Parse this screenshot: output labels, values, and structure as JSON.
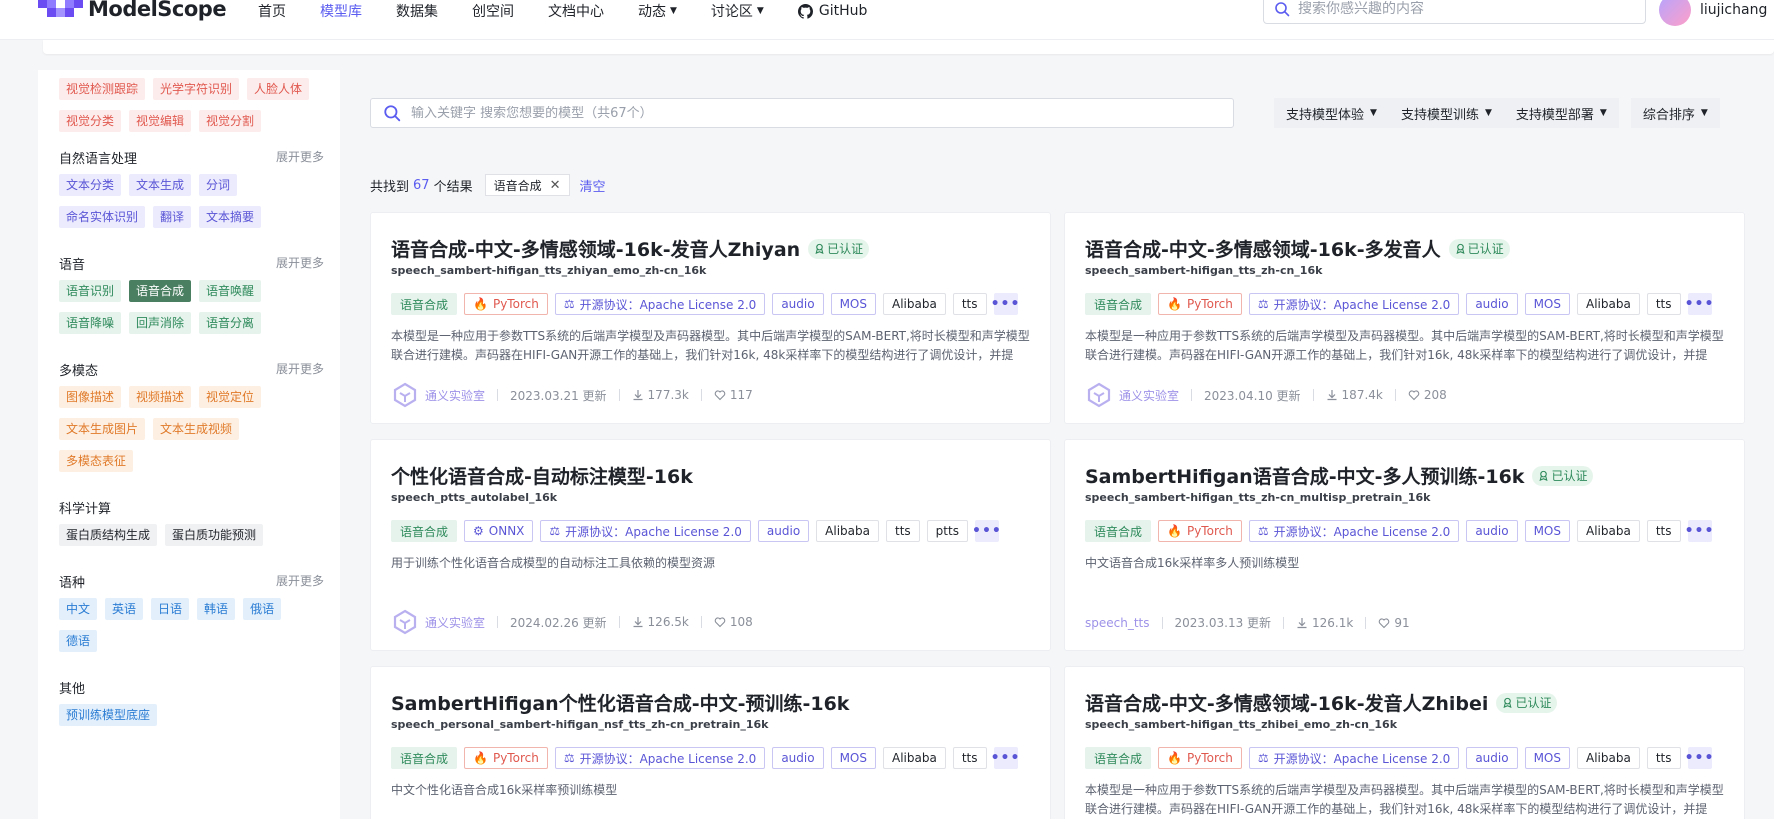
{
  "header": {
    "logo_text": "ModelScope",
    "nav": [
      {
        "label": "首页",
        "caret": false
      },
      {
        "label": "模型库",
        "caret": false
      },
      {
        "label": "数据集",
        "caret": false
      },
      {
        "label": "创空间",
        "caret": false
      },
      {
        "label": "文档中心",
        "caret": false
      },
      {
        "label": "动态",
        "caret": true
      },
      {
        "label": "讨论区",
        "caret": true
      }
    ],
    "github_label": "GitHub",
    "search_placeholder": "搜索你感兴趣的内容",
    "username": "liujichang",
    "accent": "#5b5cf0"
  },
  "sidebar": {
    "vision_tags": [
      "视觉检测跟踪",
      "光学字符识别",
      "人脸人体",
      "视觉分类",
      "视觉编辑",
      "视觉分割"
    ],
    "groups": [
      {
        "title": "自然语言处理",
        "more": "展开更多",
        "tags": [
          "文本分类",
          "文本生成",
          "分词",
          "命名实体识别",
          "翻译",
          "文本摘要"
        ]
      },
      {
        "title": "语音",
        "more": "展开更多",
        "tags": [
          "语音识别",
          "语音合成",
          "语音唤醒",
          "语音降噪",
          "回声消除",
          "语音分离"
        ],
        "active": "语音合成"
      },
      {
        "title": "多模态",
        "more": "展开更多",
        "tags": [
          "图像描述",
          "视频描述",
          "视觉定位",
          "文本生成图片",
          "文本生成视频",
          "多模态表征"
        ]
      },
      {
        "title": "科学计算",
        "tags": [
          "蛋白质结构生成",
          "蛋白质功能预测"
        ]
      },
      {
        "title": "语种",
        "more": "展开更多",
        "tags": [
          "中文",
          "英语",
          "日语",
          "韩语",
          "俄语",
          "德语"
        ]
      },
      {
        "title": "其他",
        "tags": [
          "预训练模型底座"
        ]
      }
    ]
  },
  "main": {
    "search_placeholder": "输入关键字 搜索您想要的模型（共67个）",
    "filters": [
      "支持模型体验",
      "支持模型训练",
      "支持模型部署"
    ],
    "sort_label": "综合排序",
    "result_prefix": "共找到",
    "result_count": "67",
    "result_suffix": "个结果",
    "active_filter": "语音合成",
    "clear_label": "清空",
    "cards": [
      {
        "title": "语音合成-中文-多情感领域-16k-发音人Zhiyan",
        "certified": "已认证",
        "sub": "speech_sambert-hifigan_tts_zhiyan_emo_zh-cn_16k",
        "tags": [
          "语音合成",
          "PyTorch",
          "开源协议：Apache License 2.0",
          "audio",
          "MOS",
          "Alibaba",
          "tts"
        ],
        "desc": "本模型是一种应用于参数TTS系统的后端声学模型及声码器模型。其中后端声学模型的SAM-BERT,将时长模型和声学模型联合进行建模。声码器在HIFI-GAN开源工作的基础上，我们针对16k, 48k采样率下的模型结构进行了调优设计，并提供…",
        "org": "通义实验室",
        "updated": "2023.03.21 更新",
        "downloads": "177.3k",
        "likes": "117"
      },
      {
        "title": "语音合成-中文-多情感领域-16k-多发音人",
        "certified": "已认证",
        "sub": "speech_sambert-hifigan_tts_zh-cn_16k",
        "tags": [
          "语音合成",
          "PyTorch",
          "开源协议：Apache License 2.0",
          "audio",
          "MOS",
          "Alibaba",
          "tts"
        ],
        "desc": "本模型是一种应用于参数TTS系统的后端声学模型及声码器模型。其中后端声学模型的SAM-BERT,将时长模型和声学模型联合进行建模。声码器在HIFI-GAN开源工作的基础上，我们针对16k, 48k采样率下的模型结构进行了调优设计，并提供…",
        "org": "通义实验室",
        "updated": "2023.04.10 更新",
        "downloads": "187.4k",
        "likes": "208"
      },
      {
        "title": "个性化语音合成-自动标注模型-16k",
        "certified": "",
        "sub": "speech_ptts_autolabel_16k",
        "tags": [
          "语音合成",
          "ONNX",
          "开源协议：Apache License 2.0",
          "audio",
          "Alibaba",
          "tts",
          "ptts"
        ],
        "desc": "用于训练个性化语音合成模型的自动标注工具依赖的模型资源",
        "org": "通义实验室",
        "updated": "2024.02.26 更新",
        "downloads": "126.5k",
        "likes": "108"
      },
      {
        "title": "SambertHifigan语音合成-中文-多人预训练-16k",
        "certified": "已认证",
        "sub": "speech_sambert-hifigan_tts_zh-cn_multisp_pretrain_16k",
        "tags": [
          "语音合成",
          "PyTorch",
          "开源协议：Apache License 2.0",
          "audio",
          "MOS",
          "Alibaba",
          "tts"
        ],
        "desc": "中文语音合成16k采样率多人预训练模型",
        "org": "speech_tts",
        "updated": "2023.03.13 更新",
        "downloads": "126.1k",
        "likes": "91"
      },
      {
        "title": "SambertHifigan个性化语音合成-中文-预训练-16k",
        "certified": "",
        "sub": "speech_personal_sambert-hifigan_nsf_tts_zh-cn_pretrain_16k",
        "tags": [
          "语音合成",
          "PyTorch",
          "开源协议：Apache License 2.0",
          "audio",
          "MOS",
          "Alibaba",
          "tts"
        ],
        "desc": "中文个性化语音合成16k采样率预训练模型",
        "org": "",
        "updated": "",
        "downloads": "",
        "likes": ""
      },
      {
        "title": "语音合成-中文-多情感领域-16k-发音人Zhibei",
        "certified": "已认证",
        "sub": "speech_sambert-hifigan_tts_zhibei_emo_zh-cn_16k",
        "tags": [
          "语音合成",
          "PyTorch",
          "开源协议：Apache License 2.0",
          "audio",
          "MOS",
          "Alibaba",
          "tts"
        ],
        "desc": "本模型是一种应用于参数TTS系统的后端声学模型及声码器模型。其中后端声学模型的SAM-BERT,将时长模型和声学模型联合进行建模。声码器在HIFI-GAN开源工作的基础上，我们针对16k, 48k采样率下的模型结构进行了调优设计，并提供…",
        "org": "",
        "updated": "",
        "downloads": "",
        "likes": ""
      }
    ]
  }
}
